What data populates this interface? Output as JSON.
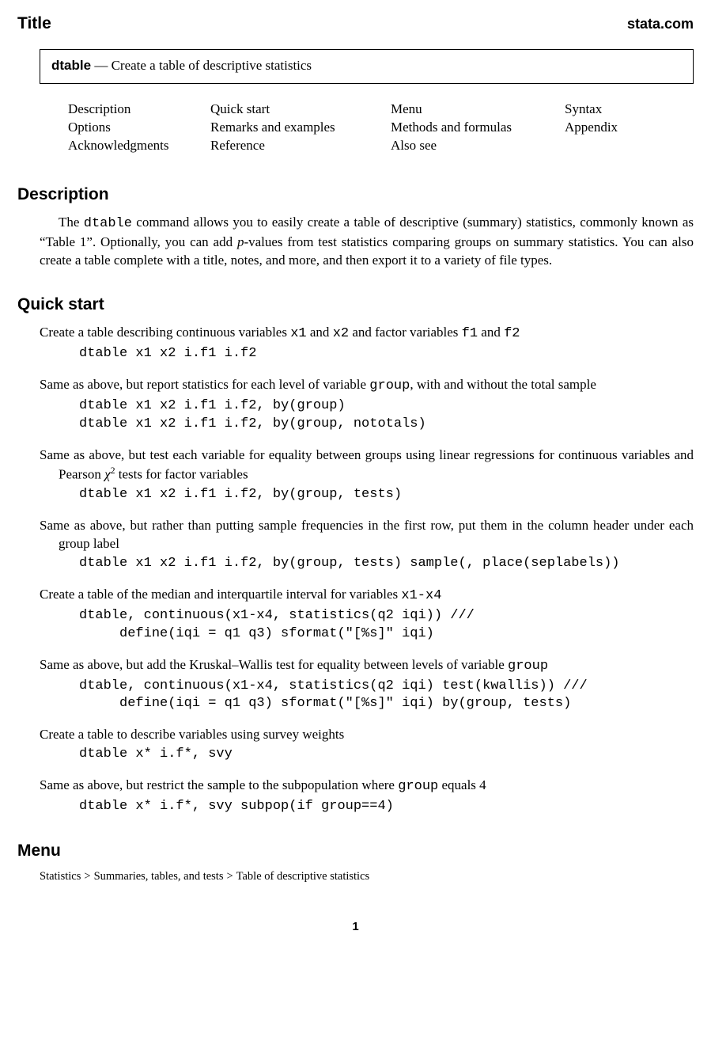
{
  "header": {
    "title": "Title",
    "site": "stata.com"
  },
  "titlebox": {
    "command": "dtable",
    "dash": " — ",
    "desc": "Create a table of descriptive statistics"
  },
  "toc": {
    "r1c1": "Description",
    "r1c2": "Quick start",
    "r1c3": "Menu",
    "r1c4": "Syntax",
    "r2c1": "Options",
    "r2c2": "Remarks and examples",
    "r2c3": "Methods and formulas",
    "r2c4": "Appendix",
    "r3c1": "Acknowledgments",
    "r3c2": "Reference",
    "r3c3": "Also see",
    "r3c4": ""
  },
  "description": {
    "heading": "Description",
    "p1a": "The ",
    "p1cmd": "dtable",
    "p1b": " command allows you to easily create a table of descriptive (summary) statistics, commonly known as “Table 1”. Optionally, you can add ",
    "p1ital": "p",
    "p1c": "-values from test statistics comparing groups on summary statistics. You can also create a table complete with a title, notes, and more, and then export it to a variety of file types."
  },
  "quickstart": {
    "heading": "Quick start",
    "b1": {
      "t1": "Create a table describing continuous variables ",
      "c1": "x1",
      "t2": " and ",
      "c2": "x2",
      "t3": " and factor variables ",
      "c3": "f1",
      "t4": " and ",
      "c4": "f2",
      "code": "dtable x1 x2 i.f1 i.f2"
    },
    "b2": {
      "t1": "Same as above, but report statistics for each level of variable ",
      "c1": "group",
      "t2": ", with and without the total sample",
      "code": "dtable x1 x2 i.f1 i.f2, by(group)\ndtable x1 x2 i.f1 i.f2, by(group, nototals)"
    },
    "b3": {
      "t1": "Same as above, but test each variable for equality between groups using linear regressions for continuous variables and Pearson ",
      "chi": "χ",
      "sup": "2",
      "t2": " tests for factor variables",
      "code": "dtable x1 x2 i.f1 i.f2, by(group, tests)"
    },
    "b4": {
      "t1": "Same as above, but rather than putting sample frequencies in the first row, put them in the column header under each group label",
      "code": "dtable x1 x2 i.f1 i.f2, by(group, tests) sample(, place(seplabels))"
    },
    "b5": {
      "t1": "Create a table of the median and interquartile interval for variables ",
      "c1": "x1-x4",
      "code": "dtable, continuous(x1-x4, statistics(q2 iqi)) ///\n     define(iqi = q1 q3) sformat(\"[%s]\" iqi)"
    },
    "b6": {
      "t1": "Same as above, but add the Kruskal–Wallis test for equality between levels of variable ",
      "c1": "group",
      "code": "dtable, continuous(x1-x4, statistics(q2 iqi) test(kwallis)) ///\n     define(iqi = q1 q3) sformat(\"[%s]\" iqi) by(group, tests)"
    },
    "b7": {
      "t1": "Create a table to describe variables using survey weights",
      "code": "dtable x* i.f*, svy"
    },
    "b8": {
      "t1": "Same as above, but restrict the sample to the subpopulation where ",
      "c1": "group",
      "t2": " equals 4",
      "code": "dtable x* i.f*, svy subpop(if group==4)"
    }
  },
  "menu": {
    "heading": "Menu",
    "p1": "Statistics",
    "p2": "Summaries, tables, and tests",
    "p3": "Table of descriptive statistics"
  },
  "page": "1"
}
